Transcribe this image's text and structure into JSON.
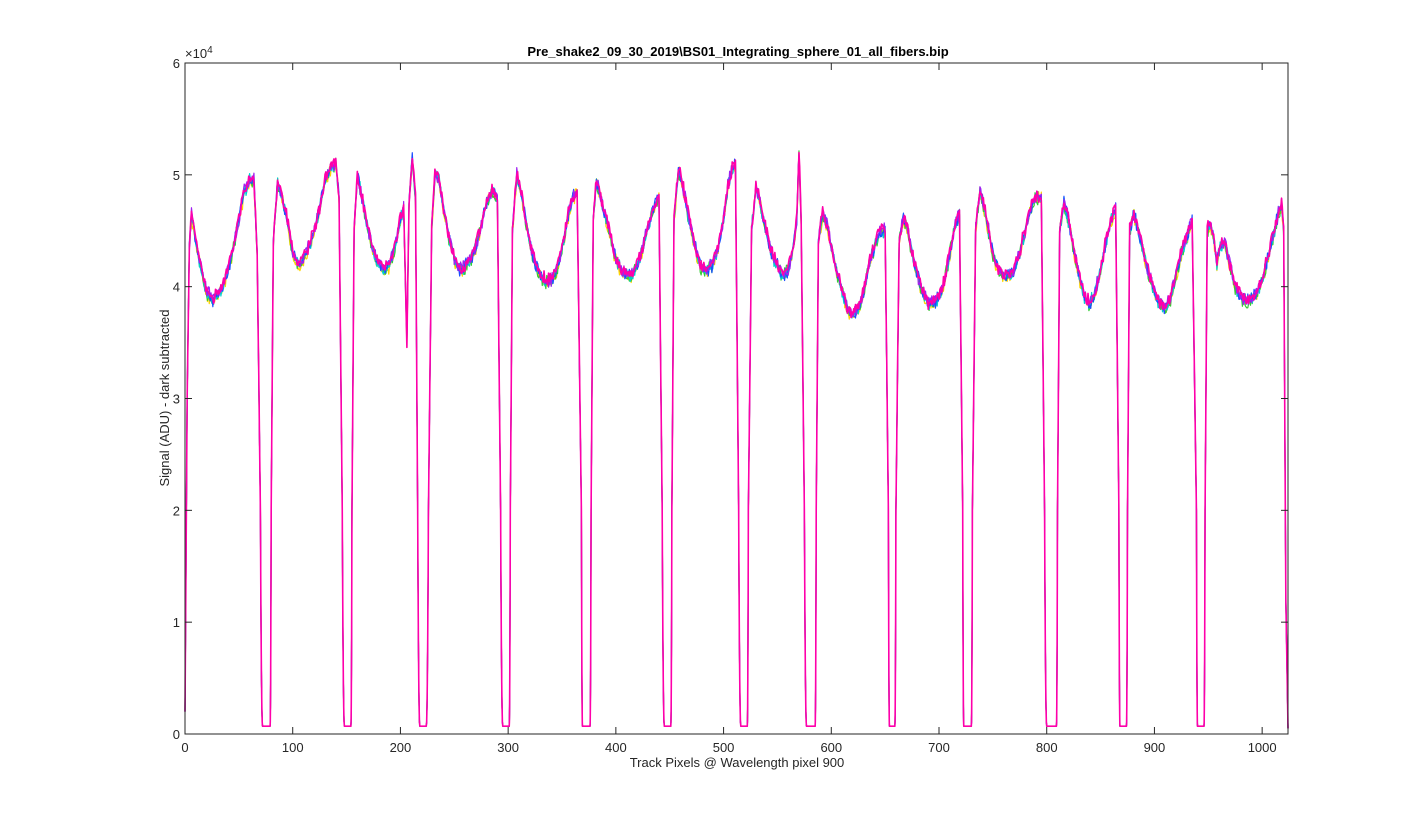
{
  "chart_data": {
    "type": "line",
    "title": "Pre_shake2_09_30_2019\\BS01_Integrating_sphere_01_all_fibers.bip",
    "xlabel": "Track Pixels @ Wavelength pixel 900",
    "ylabel": "Signal (ADU) - dark subtracted",
    "xlim": [
      0,
      1024
    ],
    "ylim": [
      0,
      60000
    ],
    "xticks": [
      0,
      100,
      200,
      300,
      400,
      500,
      600,
      700,
      800,
      900,
      1000
    ],
    "yticks": [
      0,
      10000,
      20000,
      30000,
      40000,
      50000,
      60000
    ],
    "xtick_labels": [
      "0",
      "100",
      "200",
      "300",
      "400",
      "500",
      "600",
      "700",
      "800",
      "900",
      "1000"
    ],
    "ytick_labels": [
      "0",
      "1",
      "2",
      "3",
      "4",
      "5",
      "6"
    ],
    "y_exponent_label": "×10",
    "y_exponent_power": "4",
    "grid": false,
    "legend": "none",
    "series_colors": [
      "#ffd500",
      "#33cc33",
      "#00d0d0",
      "#1a4fff",
      "#a020f0",
      "#ff00aa"
    ],
    "segments": [
      {
        "x": [
          0,
          2,
          4,
          6,
          10,
          15,
          20,
          25,
          30,
          35,
          40,
          45,
          50,
          55,
          60,
          64,
          67,
          70
        ],
        "y": [
          2000,
          30000,
          43500,
          46500,
          44000,
          41500,
          39500,
          38800,
          39200,
          40000,
          41500,
          43500,
          46000,
          48500,
          49500,
          49500,
          43000,
          20000
        ]
      },
      {
        "x": [
          80,
          82,
          86,
          90,
          95,
          100,
          105,
          110,
          115,
          120,
          125,
          130,
          135,
          140,
          143,
          146
        ],
        "y": [
          20000,
          44000,
          49500,
          48000,
          46000,
          43000,
          42000,
          42500,
          43500,
          45000,
          47000,
          49500,
          50500,
          51000,
          48000,
          20000
        ]
      },
      {
        "x": [
          155,
          157,
          160,
          165,
          170,
          175,
          180,
          185,
          190,
          195,
          200,
          203,
          206,
          208,
          211,
          214,
          216
        ],
        "y": [
          20000,
          45000,
          50000,
          47500,
          45000,
          43000,
          42000,
          41500,
          42000,
          43500,
          46000,
          47000,
          35000,
          47500,
          51500,
          48000,
          20000
        ]
      },
      {
        "x": [
          226,
          229,
          232,
          236,
          240,
          245,
          250,
          255,
          260,
          265,
          270,
          275,
          280,
          285,
          290,
          293
        ],
        "y": [
          20000,
          45000,
          50000,
          49500,
          47000,
          44500,
          42500,
          41500,
          41800,
          42500,
          43500,
          45500,
          47500,
          48500,
          48000,
          20000
        ]
      },
      {
        "x": [
          302,
          304,
          308,
          312,
          316,
          320,
          325,
          330,
          335,
          340,
          345,
          350,
          355,
          360,
          364,
          368
        ],
        "y": [
          20000,
          45000,
          50000,
          48500,
          46000,
          44000,
          42000,
          41000,
          40500,
          40500,
          41500,
          43500,
          46000,
          48000,
          48500,
          20000
        ]
      },
      {
        "x": [
          377,
          379,
          382,
          386,
          390,
          395,
          400,
          405,
          410,
          415,
          420,
          425,
          430,
          435,
          440,
          443
        ],
        "y": [
          20000,
          46000,
          49500,
          48000,
          46500,
          44500,
          42500,
          41500,
          41000,
          41000,
          42000,
          43500,
          45500,
          47000,
          48000,
          20000
        ]
      },
      {
        "x": [
          452,
          454,
          458,
          462,
          466,
          470,
          475,
          480,
          485,
          490,
          495,
          500,
          504,
          508,
          511,
          514
        ],
        "y": [
          20000,
          46000,
          50500,
          49000,
          47000,
          45000,
          43000,
          41500,
          41500,
          42000,
          43500,
          46000,
          49000,
          50500,
          51000,
          20000
        ]
      },
      {
        "x": [
          523,
          526,
          530,
          534,
          538,
          542,
          546,
          550,
          555,
          560,
          564,
          568,
          570,
          572,
          575
        ],
        "y": [
          20000,
          45000,
          49000,
          47500,
          45500,
          44000,
          42500,
          42000,
          41000,
          41500,
          43000,
          46000,
          52000,
          46000,
          20000
        ]
      },
      {
        "x": [
          586,
          588,
          592,
          596,
          600,
          605,
          610,
          615,
          620,
          625,
          630,
          635,
          640,
          645,
          650,
          653
        ],
        "y": [
          20000,
          44000,
          46500,
          45500,
          43500,
          41500,
          39500,
          38000,
          37500,
          38000,
          39500,
          42000,
          43500,
          45000,
          45000,
          20000
        ]
      },
      {
        "x": [
          660,
          663,
          667,
          671,
          675,
          680,
          685,
          690,
          695,
          700,
          705,
          710,
          715,
          719,
          722
        ],
        "y": [
          20000,
          44000,
          46000,
          45000,
          43000,
          41000,
          39500,
          38500,
          38500,
          39000,
          40500,
          43000,
          45500,
          46500,
          20000
        ]
      },
      {
        "x": [
          731,
          734,
          738,
          742,
          746,
          750,
          755,
          760,
          765,
          770,
          775,
          780,
          785,
          790,
          795,
          798
        ],
        "y": [
          20000,
          45000,
          48500,
          47000,
          45000,
          43000,
          41500,
          41000,
          41000,
          41500,
          43000,
          45000,
          47000,
          48000,
          48000,
          20000
        ]
      },
      {
        "x": [
          810,
          812,
          816,
          820,
          825,
          830,
          835,
          840,
          845,
          850,
          855,
          860,
          864,
          867
        ],
        "y": [
          20000,
          45000,
          47500,
          46000,
          43500,
          41000,
          39000,
          38500,
          39500,
          41500,
          44000,
          46000,
          47000,
          20000
        ]
      },
      {
        "x": [
          875,
          877,
          881,
          885,
          890,
          895,
          900,
          905,
          910,
          915,
          920,
          925,
          930,
          935,
          939
        ],
        "y": [
          20000,
          45000,
          46500,
          45000,
          43000,
          41000,
          39500,
          38500,
          38000,
          39000,
          41000,
          43000,
          44500,
          46000,
          20000
        ]
      },
      {
        "x": [
          947,
          949,
          952,
          955,
          958,
          961,
          965,
          970,
          975,
          980,
          985,
          990,
          995,
          1000,
          1005,
          1010,
          1015,
          1018,
          1020,
          1022,
          1024
        ],
        "y": [
          20000,
          45000,
          45500,
          44500,
          42000,
          43500,
          44000,
          42000,
          40000,
          39000,
          38800,
          39000,
          39500,
          40500,
          42500,
          44500,
          46500,
          47500,
          45000,
          12000,
          500
        ]
      }
    ],
    "dips": [
      {
        "from": 70,
        "min_start": 72,
        "min_end": 79,
        "to": 80
      },
      {
        "from": 146,
        "min_start": 148,
        "min_end": 154,
        "to": 155
      },
      {
        "from": 216,
        "min_start": 218,
        "min_end": 224,
        "to": 226
      },
      {
        "from": 293,
        "min_start": 295,
        "min_end": 301,
        "to": 302
      },
      {
        "from": 368,
        "min_start": 369,
        "min_end": 376,
        "to": 377
      },
      {
        "from": 443,
        "min_start": 445,
        "min_end": 451,
        "to": 452
      },
      {
        "from": 514,
        "min_start": 516,
        "min_end": 522,
        "to": 523
      },
      {
        "from": 575,
        "min_start": 577,
        "min_end": 585,
        "to": 586
      },
      {
        "from": 653,
        "min_start": 654,
        "min_end": 659,
        "to": 660
      },
      {
        "from": 722,
        "min_start": 723,
        "min_end": 730,
        "to": 731
      },
      {
        "from": 798,
        "min_start": 800,
        "min_end": 809,
        "to": 810
      },
      {
        "from": 867,
        "min_start": 868,
        "min_end": 874,
        "to": 875
      },
      {
        "from": 939,
        "min_start": 940,
        "min_end": 946,
        "to": 947
      }
    ],
    "dip_floor": 700
  }
}
